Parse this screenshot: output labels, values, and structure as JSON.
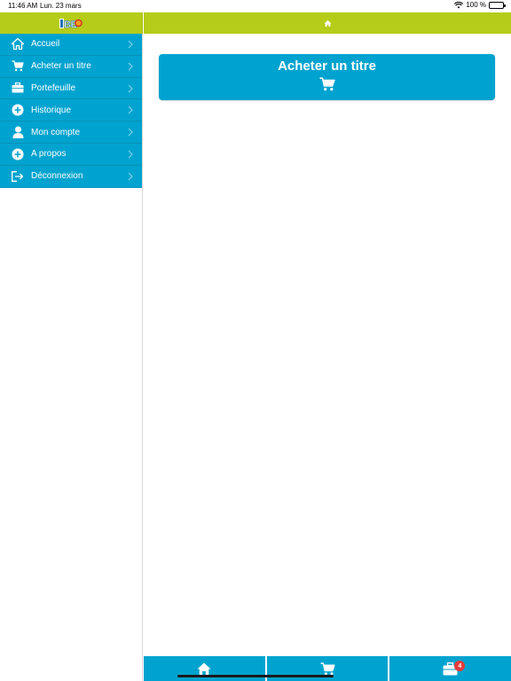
{
  "status_bar": {
    "time": "11:46 AM",
    "date": "Lun. 23 mars",
    "battery": "100 %"
  },
  "header": {
    "logo_text": "IBEO",
    "home_icon": "home-icon"
  },
  "sidebar": {
    "items": [
      {
        "label": "Accueil",
        "icon": "home-icon"
      },
      {
        "label": "Acheter un titre",
        "icon": "cart-icon"
      },
      {
        "label": "Portefeuille",
        "icon": "briefcase-icon"
      },
      {
        "label": "Historique",
        "icon": "plus-circle-icon"
      },
      {
        "label": "Mon compte",
        "icon": "user-icon"
      },
      {
        "label": "A propos",
        "icon": "plus-circle-icon"
      },
      {
        "label": "Déconnexion",
        "icon": "logout-icon"
      }
    ]
  },
  "main": {
    "buy_card": {
      "title": "Acheter un titre",
      "icon": "cart-icon"
    }
  },
  "tabbar": {
    "tabs": [
      {
        "icon": "home-icon"
      },
      {
        "icon": "cart-icon"
      },
      {
        "icon": "briefcase-icon",
        "badge": "4"
      }
    ]
  },
  "colors": {
    "header_bg": "#b5cc18",
    "accent": "#00a3cf",
    "badge": "#e23c3c"
  }
}
